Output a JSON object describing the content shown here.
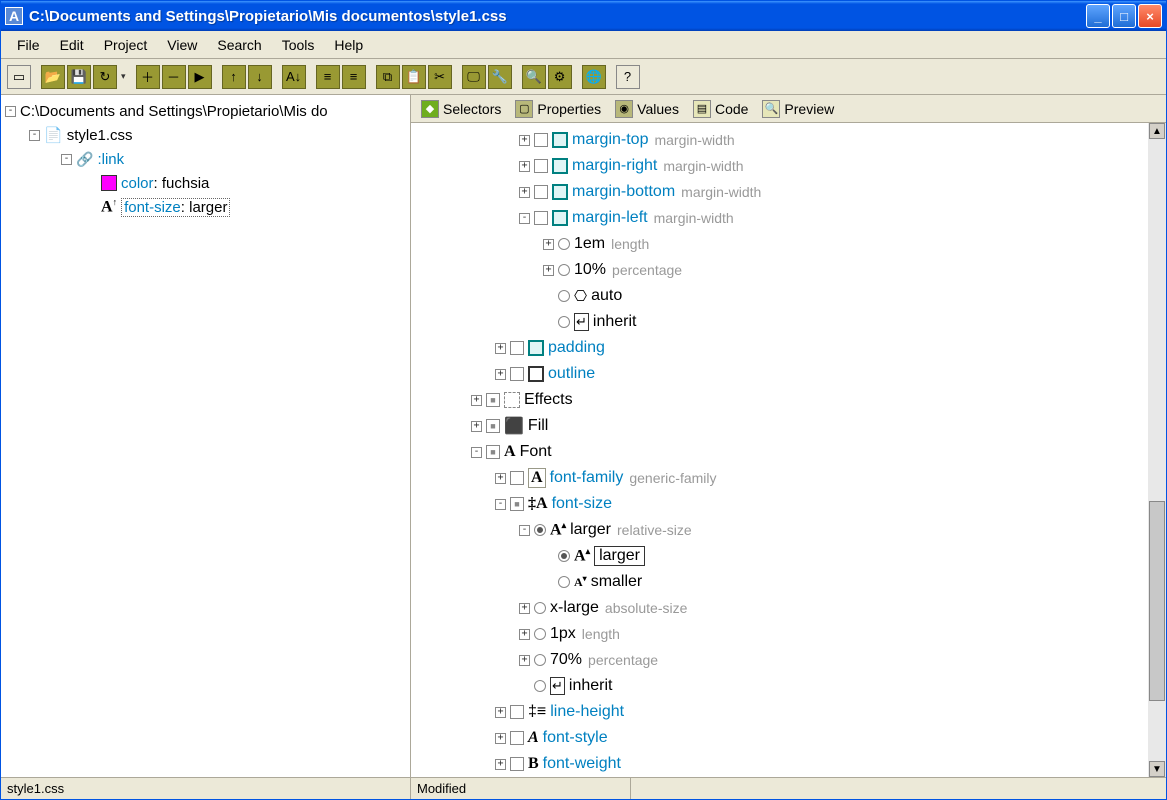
{
  "title": "C:\\Documents and Settings\\Propietario\\Mis documentos\\style1.css",
  "titleIcon": "A",
  "windowButtons": {
    "min": "_",
    "max": "□",
    "close": "×"
  },
  "menu": [
    "File",
    "Edit",
    "Project",
    "View",
    "Search",
    "Tools",
    "Help"
  ],
  "tabs": [
    {
      "label": "Selectors",
      "iconBg": "#6fae1f"
    },
    {
      "label": "Properties",
      "iconBg": "#b8b87a"
    },
    {
      "label": "Values",
      "iconBg": "#b8b87a"
    },
    {
      "label": "Code",
      "iconBg": "#e6e6b8"
    },
    {
      "label": "Preview",
      "iconBg": "#e6e6b8"
    }
  ],
  "leftTree": {
    "root": "C:\\Documents and Settings\\Propietario\\Mis do",
    "file": "style1.css",
    "selector": ":link",
    "props": [
      {
        "name": "color",
        "value": "fuchsia"
      },
      {
        "name": "font-size",
        "value": "larger",
        "selected": true
      }
    ]
  },
  "rightTree": [
    {
      "indent": 1,
      "exp": "+",
      "check": true,
      "icon": "box-teal",
      "label": "margin-top",
      "hint": "margin-width",
      "link": true
    },
    {
      "indent": 1,
      "exp": "+",
      "check": true,
      "icon": "box-teal",
      "label": "margin-right",
      "hint": "margin-width",
      "link": true
    },
    {
      "indent": 1,
      "exp": "+",
      "check": true,
      "icon": "box-teal",
      "label": "margin-bottom",
      "hint": "margin-width",
      "link": true
    },
    {
      "indent": 1,
      "exp": "-",
      "check": true,
      "icon": "box-teal",
      "label": "margin-left",
      "hint": "margin-width",
      "link": true
    },
    {
      "indent": 2,
      "exp": "+",
      "radio": true,
      "icon": "",
      "label": "1em",
      "hint": "length"
    },
    {
      "indent": 2,
      "exp": "+",
      "radio": true,
      "icon": "",
      "label": "10%",
      "hint": "percentage"
    },
    {
      "indent": 2,
      "exp": "",
      "radio": true,
      "icon": "auto",
      "label": "auto"
    },
    {
      "indent": 2,
      "exp": "",
      "radio": true,
      "icon": "inherit",
      "label": "inherit"
    },
    {
      "indent": 0,
      "exp": "+",
      "check": true,
      "icon": "box-teal",
      "label": "padding",
      "link": true
    },
    {
      "indent": 0,
      "exp": "+",
      "check": true,
      "icon": "outline",
      "label": "outline",
      "link": true
    },
    {
      "indent": -1,
      "exp": "+",
      "checkFill": true,
      "icon": "effects",
      "label": "Effects"
    },
    {
      "indent": -1,
      "exp": "+",
      "checkFill": true,
      "icon": "fill",
      "label": "Fill"
    },
    {
      "indent": -1,
      "exp": "-",
      "checkFill": true,
      "icon": "font",
      "label": "Font"
    },
    {
      "indent": 0,
      "exp": "+",
      "check": true,
      "icon": "font-family",
      "label": "font-family",
      "hint": "generic-family",
      "link": true
    },
    {
      "indent": 0,
      "exp": "-",
      "check": true,
      "checked": true,
      "icon": "font-size",
      "label": "font-size",
      "link": true
    },
    {
      "indent": 1,
      "exp": "-",
      "radio": true,
      "radioChecked": true,
      "icon": "larger",
      "label": "larger",
      "hint": "relative-size"
    },
    {
      "indent": 2,
      "exp": "",
      "radio": true,
      "radioChecked": true,
      "icon": "larger",
      "label": "larger",
      "boxed": true
    },
    {
      "indent": 2,
      "exp": "",
      "radio": true,
      "icon": "smaller",
      "label": "smaller"
    },
    {
      "indent": 1,
      "exp": "+",
      "radio": true,
      "icon": "",
      "label": "x-large",
      "hint": "absolute-size"
    },
    {
      "indent": 1,
      "exp": "+",
      "radio": true,
      "icon": "",
      "label": "1px",
      "hint": "length"
    },
    {
      "indent": 1,
      "exp": "+",
      "radio": true,
      "icon": "",
      "label": "70%",
      "hint": "percentage"
    },
    {
      "indent": 1,
      "exp": "",
      "radio": true,
      "icon": "inherit",
      "label": "inherit"
    },
    {
      "indent": 0,
      "exp": "+",
      "check": true,
      "icon": "line-height",
      "label": "line-height",
      "link": true
    },
    {
      "indent": 0,
      "exp": "+",
      "check": true,
      "icon": "font-style",
      "label": "font-style",
      "link": true
    },
    {
      "indent": 0,
      "exp": "+",
      "check": true,
      "icon": "font-weight",
      "label": "font-weight",
      "link": true
    }
  ],
  "status": {
    "file": "style1.css",
    "state": "Modified"
  }
}
